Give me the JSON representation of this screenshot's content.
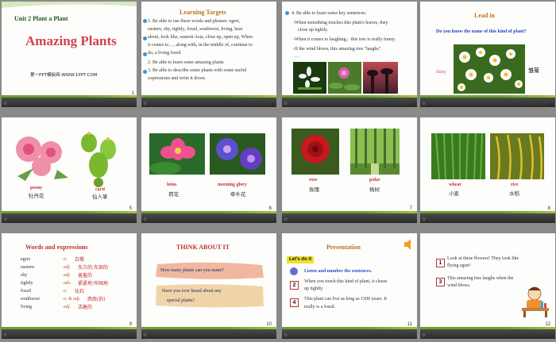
{
  "slides": [
    {
      "number": "1",
      "unit": "Unit 2  Plant a Plant",
      "title": "Amazing Plants",
      "footer": "第一PPT模板网-WWW.1PPT.COM"
    },
    {
      "number": "2",
      "heading": "Learning Targets",
      "line1": "1. Be able to use these words and phrases: egret,",
      "line2": "eastern, shy, tightly, fossil, southwest, living, hear",
      "line3": "about, look like, eastern Asia, close up, open up, When",
      "line4": "it comes to…, along with, in the middle of, continue to",
      "line5": "do, a living fossil",
      "line6": "2. Be able to learn some amazing plants",
      "line7": "3. Be able to describe some plants with some useful",
      "line8": "expressions and write it down."
    },
    {
      "number": "3",
      "line1": "4. Be able to learn some key sentences:",
      "line2": "-When something touches this plant's leaves, they",
      "line3": "close up tightly.",
      "line4": "-When it comes to laughing，this tree is really funny.",
      "line5": "-If the wind blows, this amazing tree \"laughs\".",
      "line6": "…"
    },
    {
      "number": "4",
      "heading": "Lead in",
      "question": "Do you  know  the  name  of this kind of plant?",
      "en": "daisy",
      "cn": "雏菊"
    },
    {
      "number": "5",
      "en1": "peony",
      "cn1": "牡丹花",
      "en2": "cacti",
      "cn2": "仙人掌"
    },
    {
      "number": "6",
      "en1": "lotus",
      "cn1": "荷花",
      "en2": "morning glory",
      "cn2": "牵牛花"
    },
    {
      "number": "7",
      "en1": "rose",
      "cn1": "玫瑰",
      "en2": "polar",
      "cn2": "杨树"
    },
    {
      "number": "8",
      "en1": "wheat",
      "cn1": "小麦",
      "en2": "rice",
      "cn2": "水稻"
    },
    {
      "number": "9",
      "heading": "Words and expressions",
      "words": [
        {
          "w": "egret",
          "pos": "n.",
          "cn": "白鹭"
        },
        {
          "w": "eastern",
          "pos": "adj.",
          "cn": "东方的;东部的"
        },
        {
          "w": "shy",
          "pos": "adj.",
          "cn": "害羞的"
        },
        {
          "w": "tightly",
          "pos": "adv.",
          "cn": "紧紧地;牢固地"
        },
        {
          "w": "fossil",
          "pos": "n.",
          "cn": "化石"
        },
        {
          "w": "southwest",
          "pos": "n. & adj.",
          "cn": "西南(的)"
        },
        {
          "w": "living",
          "pos": "adj.",
          "cn": "活着的"
        }
      ]
    },
    {
      "number": "10",
      "heading": "THINK ABOUT IT",
      "q1": "How  many plants can you name?",
      "q2a": "Have you ever heard about  any",
      "q2b": "special plants?"
    },
    {
      "number": "11",
      "heading": "Presentation",
      "tag": "Let's do it",
      "item1": "Listen and  number  the  sentences.",
      "n1": "1",
      "n2": "2",
      "n4": "4",
      "s2a": "When you touch this kind of plant, it closes",
      "s2b": "up tightly.",
      "s4a": "This plant can live as long as 1500 years. It",
      "s4b": "really is a fossil."
    },
    {
      "number": "12",
      "n1": "1",
      "n3": "3",
      "s1a": "Look at these flowers! They look like",
      "s1b": "flying egret!",
      "s3a": "This amazing tree laughs when the",
      "s3b": "wind blows."
    }
  ]
}
